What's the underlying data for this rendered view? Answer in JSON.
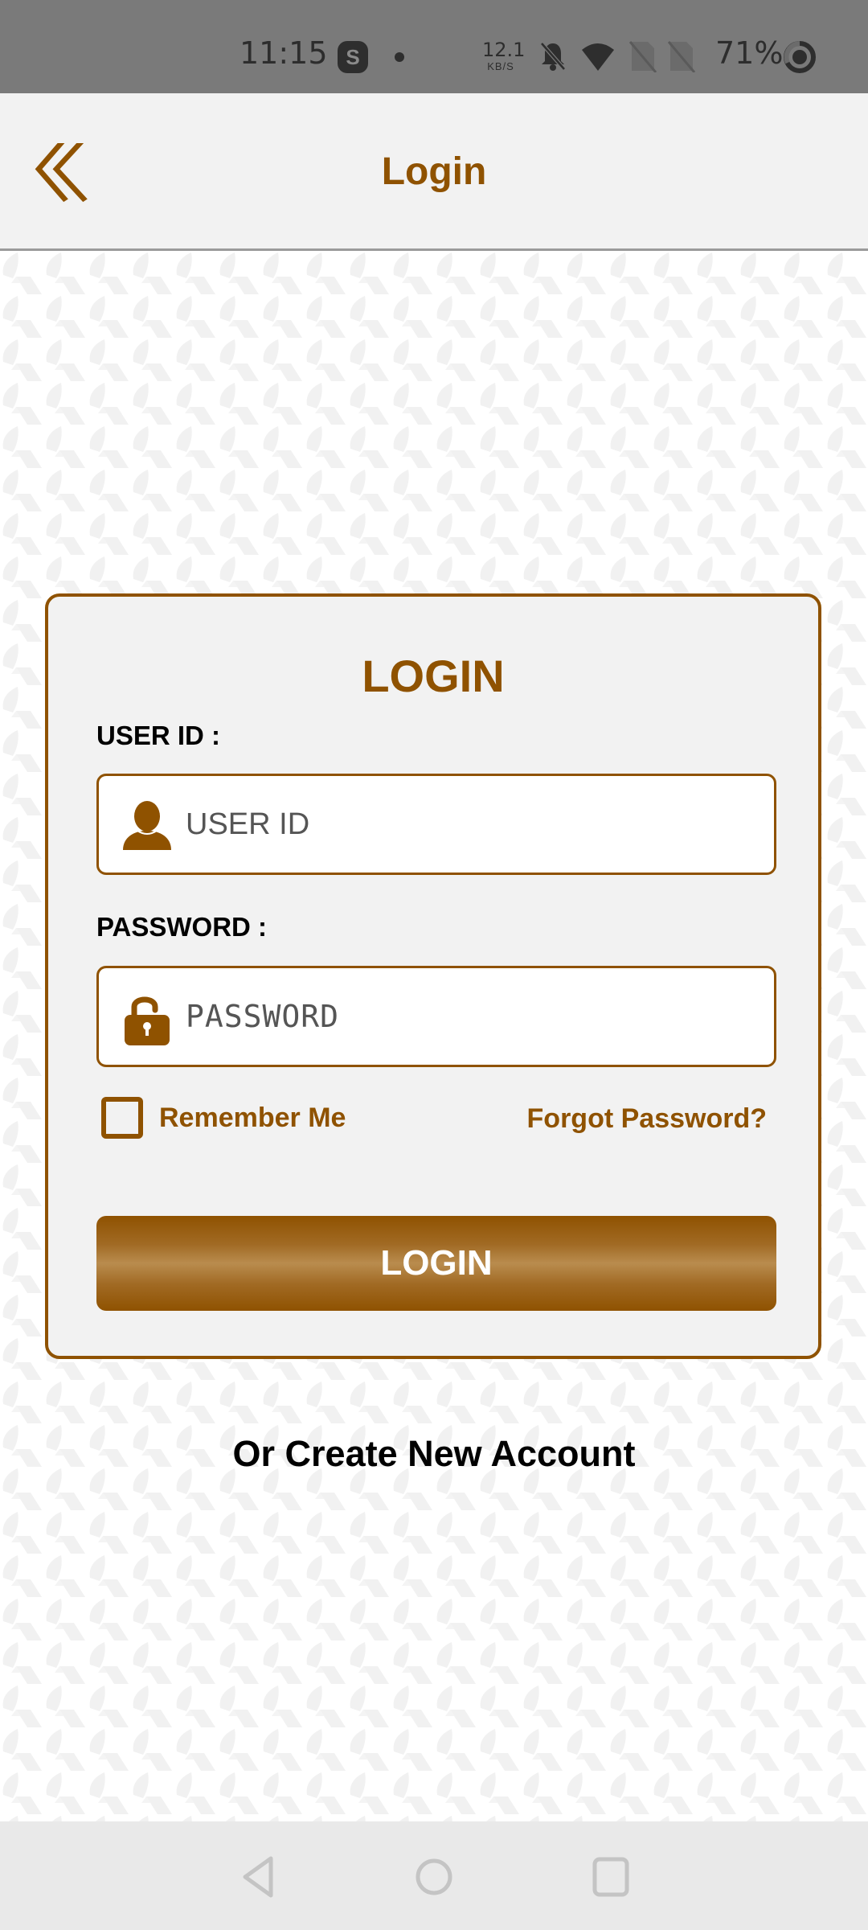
{
  "status_bar": {
    "time": "11:15",
    "notification_app_icon": "skype-icon",
    "notification_app_letter": "S",
    "net_speed_value": "12.1",
    "net_speed_unit": "KB/S",
    "icons": [
      "bell-off-icon",
      "wifi-icon",
      "no-sim-icon",
      "no-sim-icon"
    ],
    "battery_percent": "71%"
  },
  "header": {
    "back_icon": "double-chevron-left-icon",
    "title": "Login"
  },
  "card": {
    "title": "LOGIN",
    "user_id": {
      "label": "USER ID :",
      "placeholder": "USER ID",
      "value": "",
      "icon": "user-icon"
    },
    "password": {
      "label": "PASSWORD :",
      "placeholder": "PASSWORD",
      "value": "",
      "icon": "unlock-icon"
    },
    "remember_me": {
      "label": "Remember Me",
      "checked": false
    },
    "forgot_password": "Forgot Password?",
    "login_button": "LOGIN"
  },
  "create_account": "Or Create New Account",
  "nav_bar": {
    "buttons": [
      "back",
      "home",
      "recents"
    ]
  },
  "colors": {
    "brand": "#8f5200",
    "card_bg": "#f2f2f2",
    "header_bg": "#f2f2f2",
    "status_bar_bg": "#7a7a7a",
    "nav_bar_bg": "#e9e9e9"
  }
}
